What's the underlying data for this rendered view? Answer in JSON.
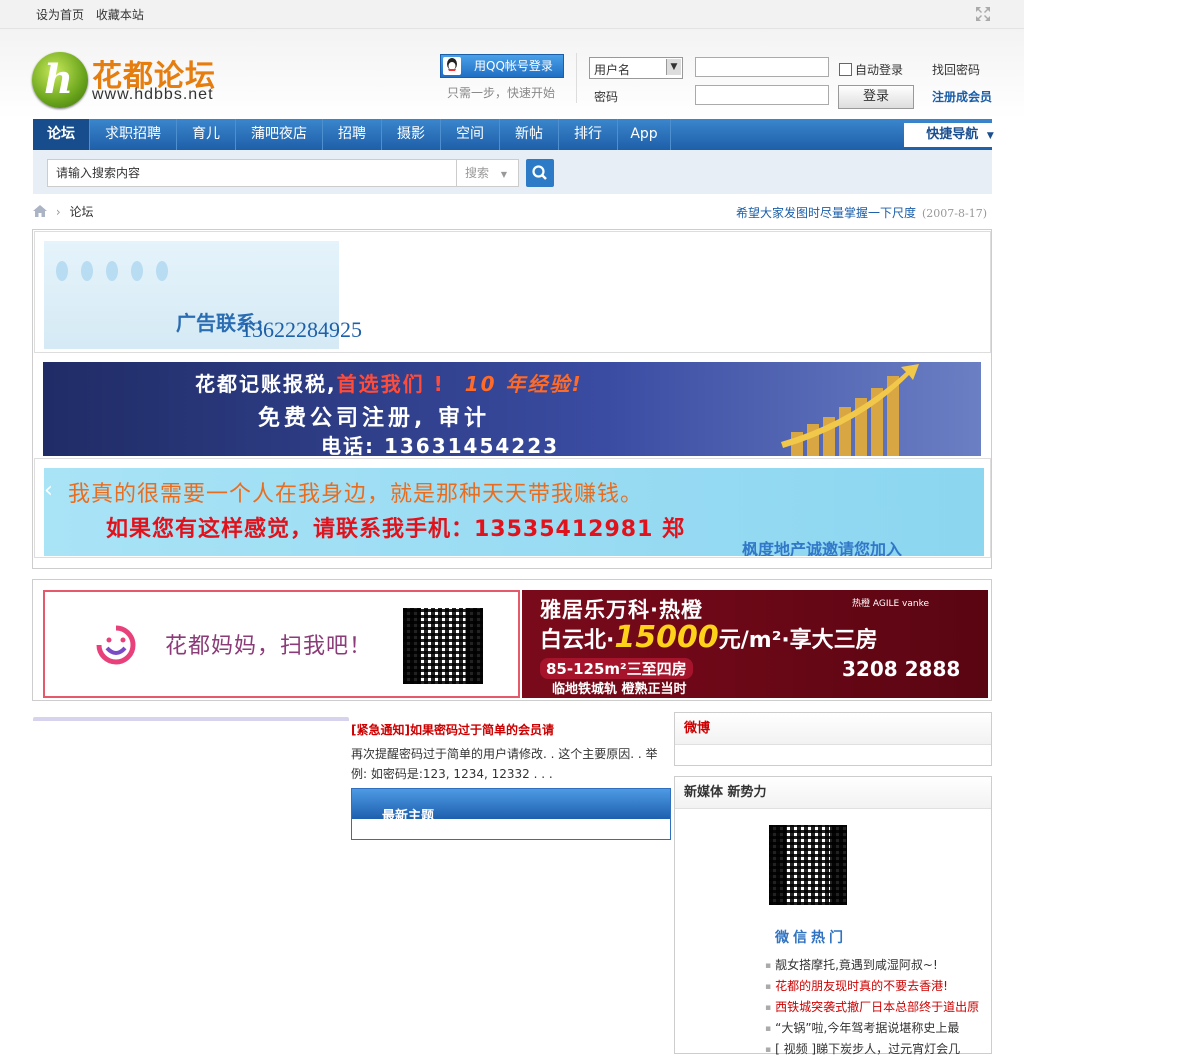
{
  "topbar": {
    "set_home": "设为首页",
    "bookmark": "收藏本站"
  },
  "logo": {
    "title": "花都论坛",
    "url": "www.hdbbs.net"
  },
  "login": {
    "qq_label": "用QQ帐号登录",
    "qq_hint": "只需一步，快速开始",
    "username_type": "用户名",
    "password_label": "密码",
    "auto_login": "自动登录",
    "submit": "登录",
    "find_password": "找回密码",
    "register": "注册成会员"
  },
  "nav": {
    "items": [
      "论坛",
      "求职招聘",
      "育儿",
      "蒲吧夜店",
      "招聘",
      "摄影",
      "空间",
      "新帖",
      "排行",
      "App"
    ],
    "quick_nav": "快捷导航"
  },
  "search": {
    "placeholder": "请输入搜索内容",
    "type": "搜索"
  },
  "breadcrumb": {
    "current": "论坛"
  },
  "notice": {
    "text": "希望大家发图时尽量掌握一下尺度",
    "date": "(2007-8-17)"
  },
  "ads": {
    "ad1": {
      "label": "广告联系:",
      "phone": "13622284925"
    },
    "ad2": {
      "line1_a": "花都记账报税,",
      "line1_b": "首选我们 !",
      "line1_c": "10 年经验!",
      "line2": "免费公司注册, 审计",
      "line3": "电话: 13631454223"
    },
    "ad3": {
      "line1": "我真的很需要一个人在我身边，就是那种天天带我赚钱。",
      "line2": "如果您有这样感觉，请联系我手机：13535412981 郑",
      "line3": "枫度地产诚邀请您加入"
    },
    "ad4": {
      "text": "花都妈妈，扫我吧！"
    },
    "ad5": {
      "title": "雅居乐万科·热橙",
      "line2_a": "白云北·",
      "price": "15000",
      "line2_b": "元/m²·享大三房",
      "area": "85-125m²三至四房",
      "slogan": "临地铁城轨 橙熟正当时",
      "brand": "热橙 AGILE vanke",
      "tel": "3208 2888"
    }
  },
  "urgent": {
    "title": "[紧急通知]如果密码过于简单的会员请",
    "body": "再次提醒密码过于简单的用户请修改. . 这个主要原因. . 举例: 如密码是:123, 1234, 12332 . . ."
  },
  "latest": {
    "title": "最新主题"
  },
  "weibo": {
    "title": "微博"
  },
  "newmedia": {
    "title": "新媒体 新势力",
    "hot_title": "微信热门",
    "items": [
      {
        "text": "靓女搭摩托,竟遇到咸湿阿叔~!",
        "red": false
      },
      {
        "text": "花都的朋友现时真的不要去香港!",
        "red": true
      },
      {
        "text": "西铁城突袭式撤厂日本总部终于道出原",
        "red": true
      },
      {
        "text": "“大锅”啦,今年驾考据说堪称史上最",
        "red": false
      },
      {
        "text": "[ 视频 ]睇下炭步人，过元宵灯会几",
        "red": false
      }
    ]
  }
}
